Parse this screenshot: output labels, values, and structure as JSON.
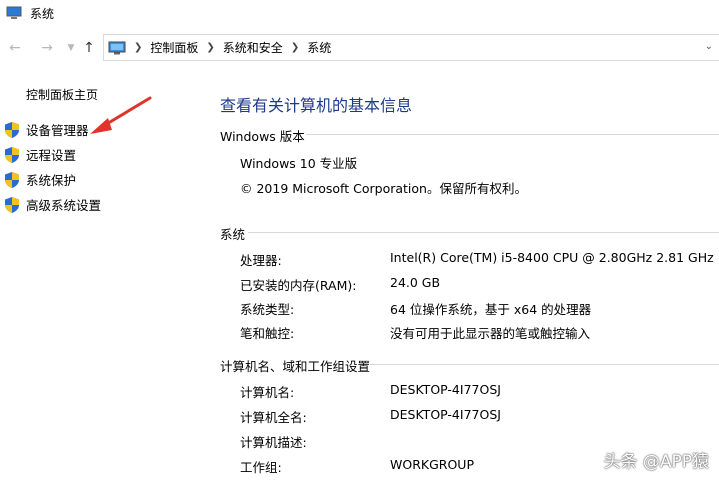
{
  "window": {
    "title": "系统"
  },
  "nav": {
    "back_icon": "arrow-left-icon",
    "forward_icon": "arrow-right-icon",
    "recent_icon": "chevron-down-icon",
    "up_icon": "arrow-up-icon"
  },
  "breadcrumb": {
    "items": [
      "控制面板",
      "系统和安全",
      "系统"
    ]
  },
  "sidebar": {
    "home": "控制面板主页",
    "links": [
      {
        "label": "设备管理器",
        "icon": "shield-icon"
      },
      {
        "label": "远程设置",
        "icon": "shield-icon"
      },
      {
        "label": "系统保护",
        "icon": "shield-icon"
      },
      {
        "label": "高级系统设置",
        "icon": "shield-icon"
      }
    ]
  },
  "main": {
    "title": "查看有关计算机的基本信息",
    "windows_section": {
      "heading": "Windows 版本",
      "edition": "Windows 10 专业版",
      "copyright": "© 2019 Microsoft Corporation。保留所有权利。"
    },
    "system_section": {
      "heading": "系统",
      "rows": [
        {
          "label": "处理器:",
          "value": "Intel(R) Core(TM) i5-8400 CPU @ 2.80GHz   2.81 GHz"
        },
        {
          "label": "已安装的内存(RAM):",
          "value": "24.0 GB"
        },
        {
          "label": "系统类型:",
          "value": "64 位操作系统，基于 x64 的处理器"
        },
        {
          "label": "笔和触控:",
          "value": "没有可用于此显示器的笔或触控输入"
        }
      ]
    },
    "computer_section": {
      "heading": "计算机名、域和工作组设置",
      "rows": [
        {
          "label": "计算机名:",
          "value": "DESKTOP-4I77OSJ"
        },
        {
          "label": "计算机全名:",
          "value": "DESKTOP-4I77OSJ"
        },
        {
          "label": "计算机描述:",
          "value": ""
        },
        {
          "label": "工作组:",
          "value": "WORKGROUP"
        }
      ]
    }
  },
  "watermark": "头条 @APP猿",
  "colors": {
    "title_blue": "#1c3a8c",
    "arrow_red": "#e0332c",
    "shield_blue": "#2a6bd1",
    "shield_yellow": "#f2c31a"
  }
}
